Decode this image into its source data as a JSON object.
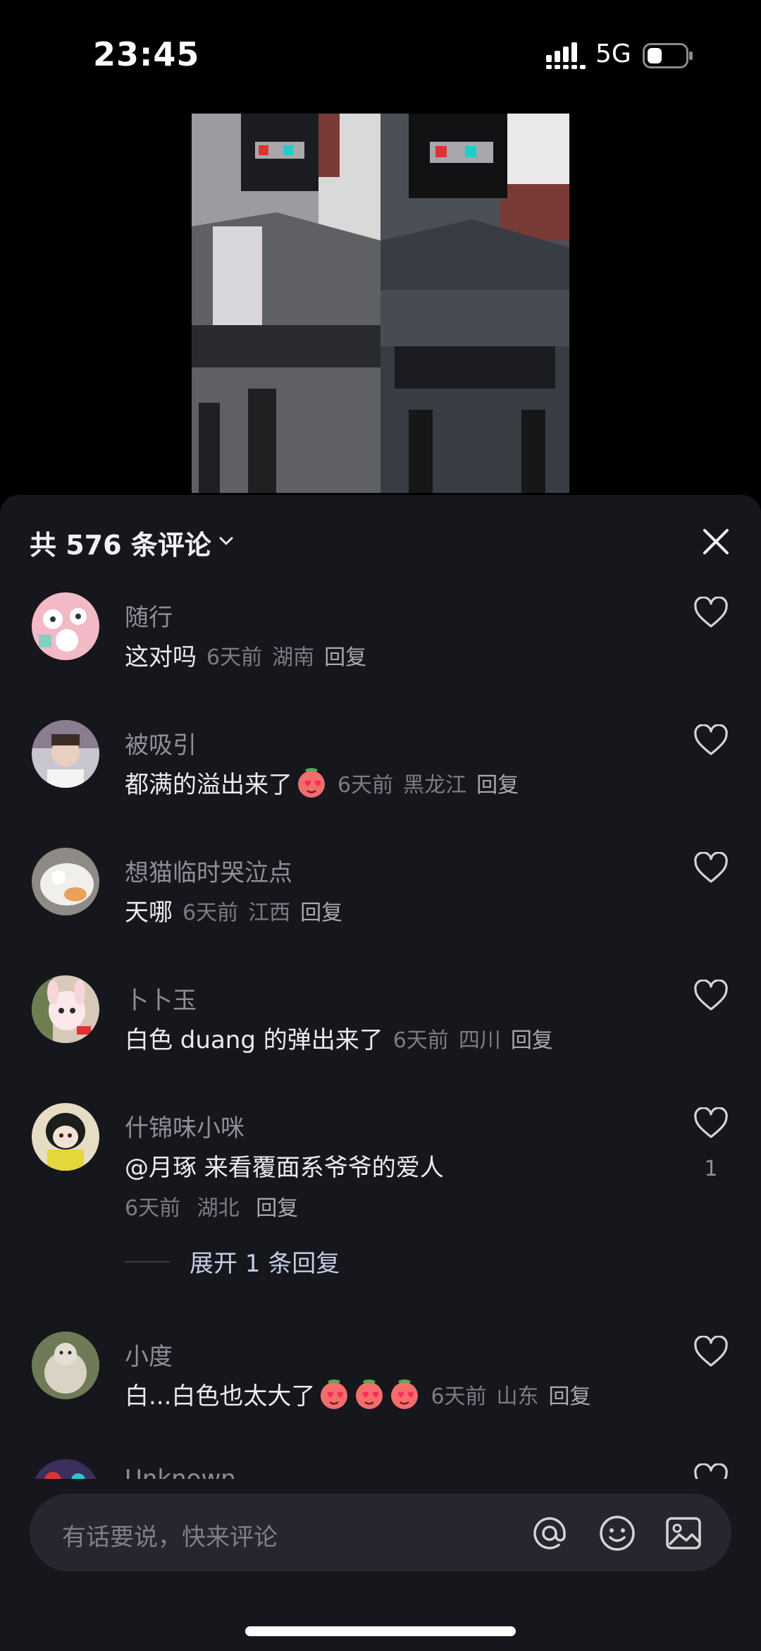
{
  "status_bar": {
    "time": "23:45",
    "network": "5G"
  },
  "comments_panel": {
    "count_label": "共 576 条评论",
    "comments": [
      {
        "username": "随行",
        "text": "这对吗",
        "time": "6天前",
        "location": "湖南",
        "reply_label": "回复"
      },
      {
        "username": "被吸引",
        "text": "都满的溢出来了",
        "emoji_count": 1,
        "time": "6天前",
        "location": "黑龙江",
        "reply_label": "回复"
      },
      {
        "username": "想猫临时哭泣点",
        "text": "天哪",
        "time": "6天前",
        "location": "江西",
        "reply_label": "回复"
      },
      {
        "username": "卜卜玉",
        "text": "白色 duang 的弹出来了",
        "time": "6天前",
        "location": "四川",
        "reply_label": "回复"
      },
      {
        "username": "什锦味小咪",
        "text": "@月琢 来看覆面系爷爷的爱人",
        "time": "6天前",
        "location": "湖北",
        "reply_label": "回复",
        "likes": "1",
        "expand_label": "展开 1 条回复"
      },
      {
        "username": "小度",
        "text": "白...白色也太大了",
        "emoji_count": 3,
        "time": "6天前",
        "location": "山东",
        "reply_label": "回复"
      },
      {
        "username": "Unknown"
      }
    ]
  },
  "input_bar": {
    "placeholder": "有话要说，快来评论"
  },
  "colors": {
    "sheet_bg": "#16161d",
    "input_bg": "#26262e",
    "text_primary": "#ececef",
    "text_secondary": "#8e8e96"
  }
}
